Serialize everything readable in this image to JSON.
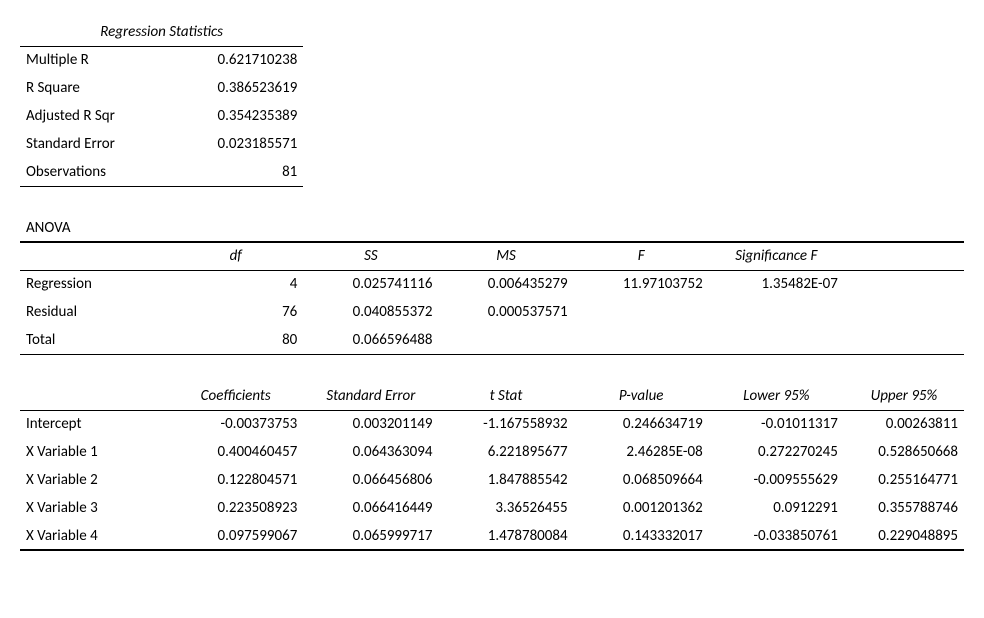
{
  "regstats": {
    "title": "Regression Statistics",
    "rows": [
      {
        "label": "Multiple R",
        "value": "0.621710238"
      },
      {
        "label": "R Square",
        "value": "0.386523619"
      },
      {
        "label": "Adjusted R Sqr",
        "value": "0.354235389"
      },
      {
        "label": "Standard Error",
        "value": "0.023185571"
      },
      {
        "label": "Observations",
        "value": "81"
      }
    ]
  },
  "anova": {
    "title": "ANOVA",
    "headers": {
      "df": "df",
      "ss": "SS",
      "ms": "MS",
      "f": "F",
      "sigf": "Significance F"
    },
    "rows": [
      {
        "label": "Regression",
        "df": "4",
        "ss": "0.025741116",
        "ms": "0.006435279",
        "f": "11.97103752",
        "sigf": "1.35482E-07"
      },
      {
        "label": "Residual",
        "df": "76",
        "ss": "0.040855372",
        "ms": "0.000537571",
        "f": "",
        "sigf": ""
      },
      {
        "label": "Total",
        "df": "80",
        "ss": "0.066596488",
        "ms": "",
        "f": "",
        "sigf": ""
      }
    ]
  },
  "coef": {
    "headers": {
      "coef": "Coefficients",
      "se": "Standard Error",
      "tstat": "t Stat",
      "pval": "P-value",
      "lower": "Lower 95%",
      "upper": "Upper 95%"
    },
    "rows": [
      {
        "label": "Intercept",
        "coef": "-0.00373753",
        "se": "0.003201149",
        "tstat": "-1.167558932",
        "pval": "0.246634719",
        "lower": "-0.01011317",
        "upper": "0.00263811"
      },
      {
        "label": "X Variable 1",
        "coef": "0.400460457",
        "se": "0.064363094",
        "tstat": "6.221895677",
        "pval": "2.46285E-08",
        "lower": "0.272270245",
        "upper": "0.528650668"
      },
      {
        "label": "X Variable 2",
        "coef": "0.122804571",
        "se": "0.066456806",
        "tstat": "1.847885542",
        "pval": "0.068509664",
        "lower": "-0.009555629",
        "upper": "0.255164771"
      },
      {
        "label": "X Variable 3",
        "coef": "0.223508923",
        "se": "0.066416449",
        "tstat": "3.36526455",
        "pval": "0.001201362",
        "lower": "0.0912291",
        "upper": "0.355788746"
      },
      {
        "label": "X Variable 4",
        "coef": "0.097599067",
        "se": "0.065999717",
        "tstat": "1.478780084",
        "pval": "0.143332017",
        "lower": "-0.033850761",
        "upper": "0.229048895"
      }
    ]
  }
}
